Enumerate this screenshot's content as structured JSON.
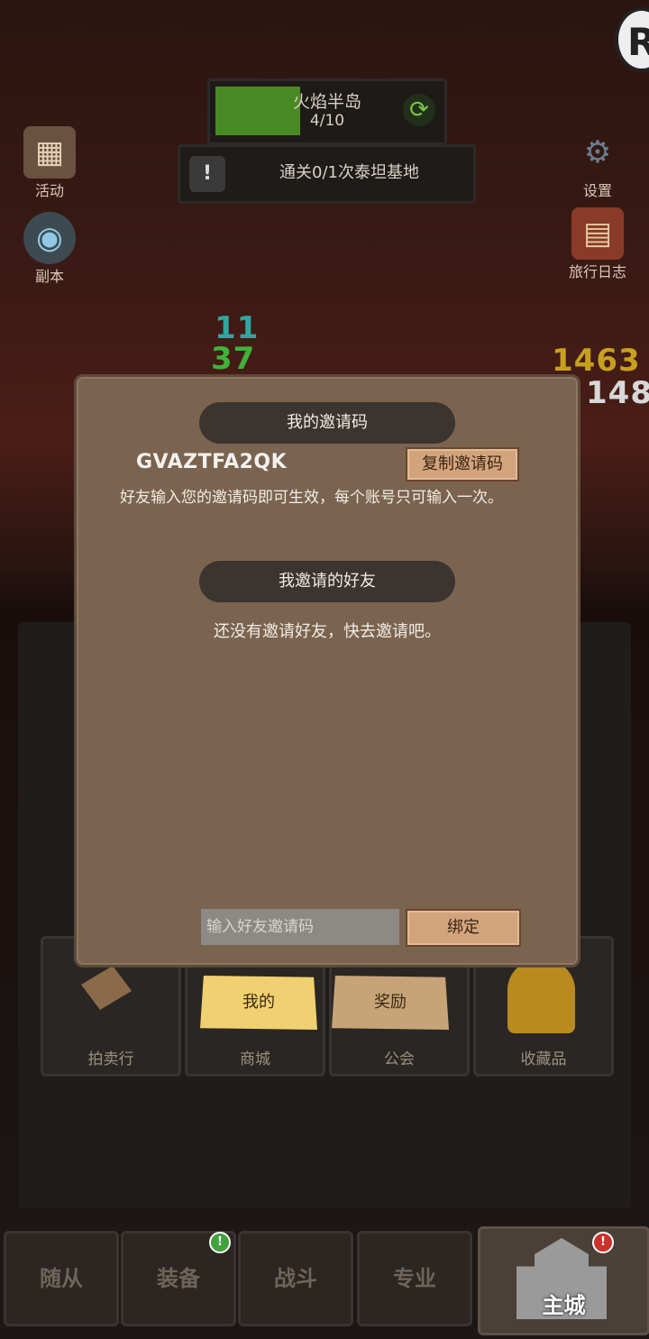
{
  "stage": {
    "name": "火焰半岛",
    "progress": "4/10",
    "fill_fraction": 0.38
  },
  "quest": {
    "text": "通关0/1次泰坦基地"
  },
  "side_left": [
    {
      "label": "活动",
      "icon": "calendar-icon"
    },
    {
      "label": "副本",
      "icon": "portal-icon"
    }
  ],
  "side_right": [
    {
      "label": "设置",
      "icon": "gear-icon"
    },
    {
      "label": "旅行日志",
      "icon": "journal-icon"
    }
  ],
  "damage": {
    "green_top": "11",
    "green_bottom": "37",
    "yellow": "1463",
    "white": "148"
  },
  "grid": {
    "auction": "拍卖行",
    "shop": "商城",
    "guild": "公会",
    "collection": "收藏品"
  },
  "tabs": {
    "mine": "我的",
    "reward": "奖励"
  },
  "nav": {
    "followers": "随从",
    "equipment": "装备",
    "battle": "战斗",
    "profession": "专业",
    "main_city": "主城"
  },
  "dialog": {
    "my_code_title": "我的邀请码",
    "invite_code": "GVAZTFA2QK",
    "copy_button": "复制邀请码",
    "description": "好友输入您的邀请码即可生效，每个账号只可输入一次。",
    "invited_title": "我邀请的好友",
    "empty_text": "还没有邀请好友，快去邀请吧。",
    "input_placeholder": "输入好友邀请码",
    "bind_button": "绑定"
  },
  "colors": {
    "accent_green": "#4a8a24",
    "dialog_bg": "#7a6450",
    "wood_button": "#d3a47c",
    "tab_active": "#f0d070"
  }
}
